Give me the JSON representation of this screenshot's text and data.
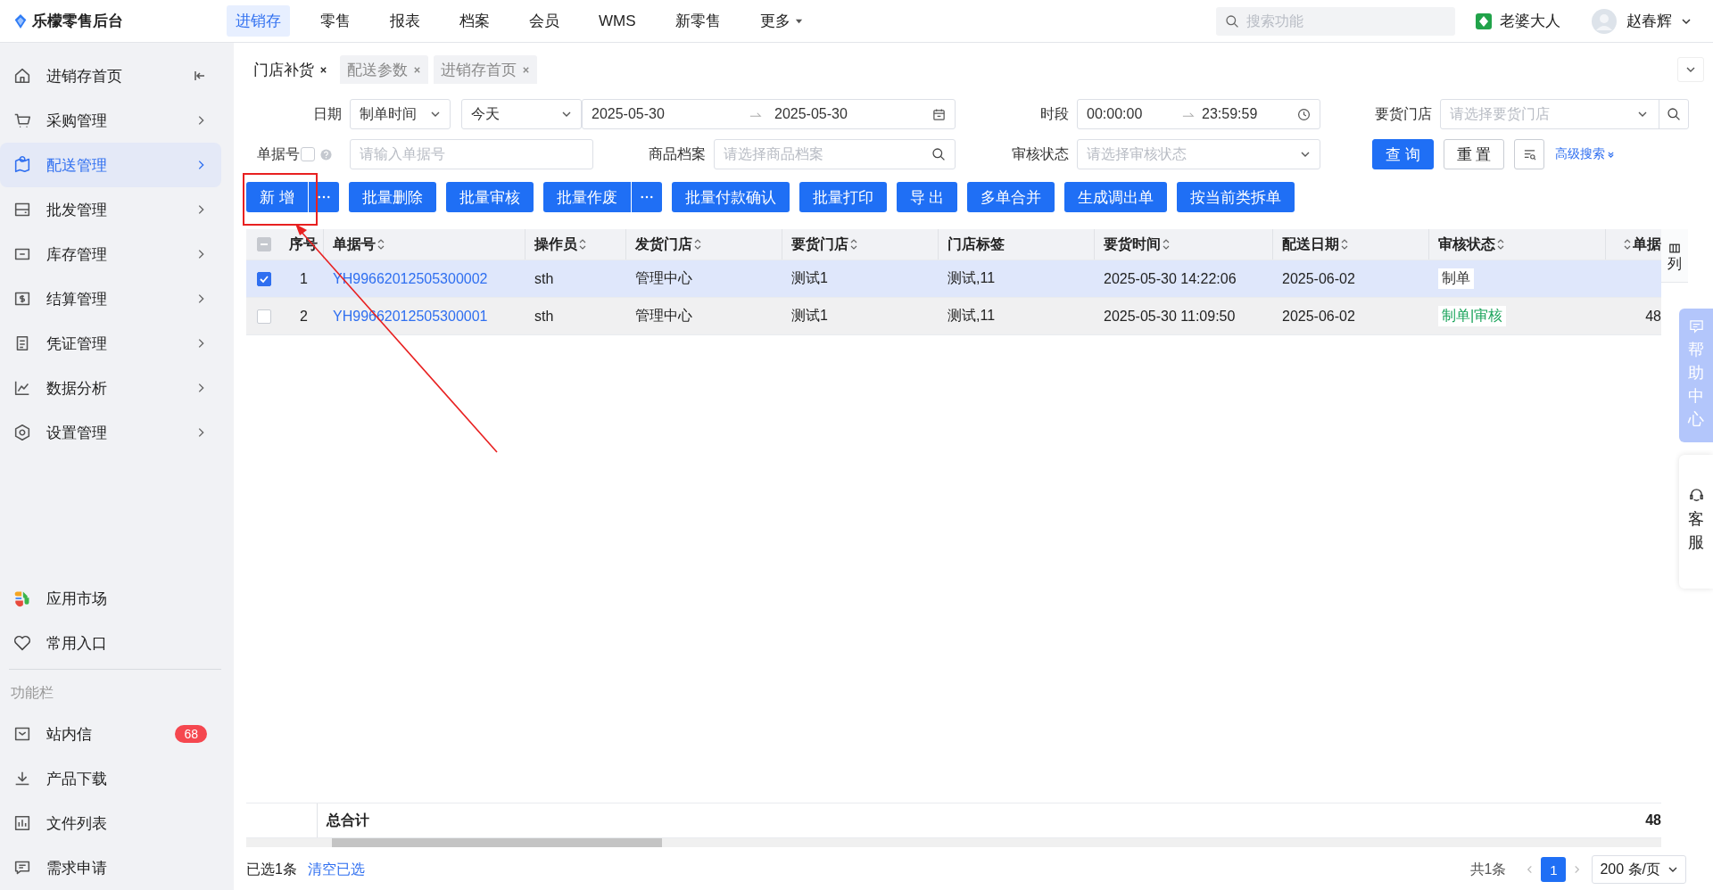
{
  "app": {
    "title": "乐檬零售后台"
  },
  "nav": [
    {
      "label": "进销存",
      "selected": true
    },
    {
      "label": "零售",
      "selected": false
    },
    {
      "label": "报表",
      "selected": false
    },
    {
      "label": "档案",
      "selected": false
    },
    {
      "label": "会员",
      "selected": false
    },
    {
      "label": "WMS",
      "selected": false
    },
    {
      "label": "新零售",
      "selected": false
    },
    {
      "label": "更多",
      "selected": false,
      "dropdown": true
    }
  ],
  "search": {
    "placeholder": "搜索功能"
  },
  "shop": {
    "name": "老婆大人"
  },
  "user": {
    "name": "赵春辉"
  },
  "sidebar": {
    "items": [
      {
        "label": "进销存首页",
        "selected": false
      },
      {
        "label": "采购管理",
        "selected": false
      },
      {
        "label": "配送管理",
        "selected": true
      },
      {
        "label": "批发管理",
        "selected": false
      },
      {
        "label": "库存管理",
        "selected": false
      },
      {
        "label": "结算管理",
        "selected": false
      },
      {
        "label": "凭证管理",
        "selected": false
      },
      {
        "label": "数据分析",
        "selected": false
      },
      {
        "label": "设置管理",
        "selected": false
      }
    ],
    "bottom_items": [
      {
        "label": "应用市场"
      },
      {
        "label": "常用入口"
      }
    ],
    "section_title": "功能栏",
    "function_items": [
      {
        "label": "站内信",
        "badge": "68"
      },
      {
        "label": "产品下载"
      },
      {
        "label": "文件列表"
      },
      {
        "label": "需求申请"
      }
    ]
  },
  "tabs": [
    {
      "label": "门店补货",
      "selected": true
    },
    {
      "label": "配送参数",
      "selected": false
    },
    {
      "label": "进销存首页",
      "selected": false
    }
  ],
  "filters": {
    "date_label": "日期",
    "date_type": "制单时间",
    "date_preset": "今天",
    "date_from": "2025-05-30",
    "date_to": "2025-05-30",
    "period_label": "时段",
    "time_from": "00:00:00",
    "time_to": "23:59:59",
    "store_label": "要货门店",
    "store_placeholder": "请选择要货门店",
    "doc_label": "单据号",
    "doc_toggle_checked": false,
    "doc_placeholder": "请输入单据号",
    "goods_label": "商品档案",
    "goods_placeholder": "请选择商品档案",
    "status_label": "审核状态",
    "status_placeholder": "请选择审核状态",
    "query": "查 询",
    "reset": "重 置",
    "advanced": "高级搜索"
  },
  "actions": [
    {
      "label": "新 增",
      "more": true
    },
    {
      "label": "批量删除",
      "more": false
    },
    {
      "label": "批量审核",
      "more": false
    },
    {
      "label": "批量作废",
      "more": true
    },
    {
      "label": "批量付款确认",
      "more": false
    },
    {
      "label": "批量打印",
      "more": false
    },
    {
      "label": "导 出",
      "more": false
    },
    {
      "label": "多单合并",
      "more": false
    },
    {
      "label": "生成调出单",
      "more": false
    },
    {
      "label": "按当前类拆单",
      "more": false
    }
  ],
  "table": {
    "select_all_partial": true,
    "column_settings": "列",
    "columns": [
      {
        "label": "序号",
        "sortable": false
      },
      {
        "label": "单据号",
        "sortable": true
      },
      {
        "label": "操作员",
        "sortable": true
      },
      {
        "label": "发货门店",
        "sortable": true
      },
      {
        "label": "要货门店",
        "sortable": true
      },
      {
        "label": "门店标签",
        "sortable": false
      },
      {
        "label": "要货时间",
        "sortable": true
      },
      {
        "label": "配送日期",
        "sortable": true
      },
      {
        "label": "审核状态",
        "sortable": true
      },
      {
        "label": "单据",
        "sortable": true
      }
    ],
    "rows": [
      {
        "selected": true,
        "index": "1",
        "doc_no": "YH99662012505300002",
        "operator": "sth",
        "from_store": "管理中心",
        "to_store": "测试1",
        "tag": "测试,11",
        "request_time": "2025-05-30 14:22:06",
        "delivery_date": "2025-06-02",
        "status": {
          "text": "制单",
          "color": "#333333"
        }
      },
      {
        "selected": false,
        "index": "2",
        "doc_no": "YH99662012505300001",
        "operator": "sth",
        "from_store": "管理中心",
        "to_store": "测试1",
        "tag": "测试,11",
        "request_time": "2025-05-30 11:09:50",
        "delivery_date": "2025-06-02",
        "status": {
          "text": "制单|审核",
          "color": "#19a35a"
        },
        "column_10": "48"
      }
    ],
    "total_label": "总合计",
    "total_value": "48"
  },
  "footer": {
    "selected_count": "已选1条",
    "clear": "清空已选",
    "total": "共1条",
    "pages": [
      {
        "label": "1",
        "selected": true
      }
    ],
    "page_size": "200 条/页"
  },
  "side_panels": {
    "help": "帮助中心",
    "service": "客服"
  }
}
